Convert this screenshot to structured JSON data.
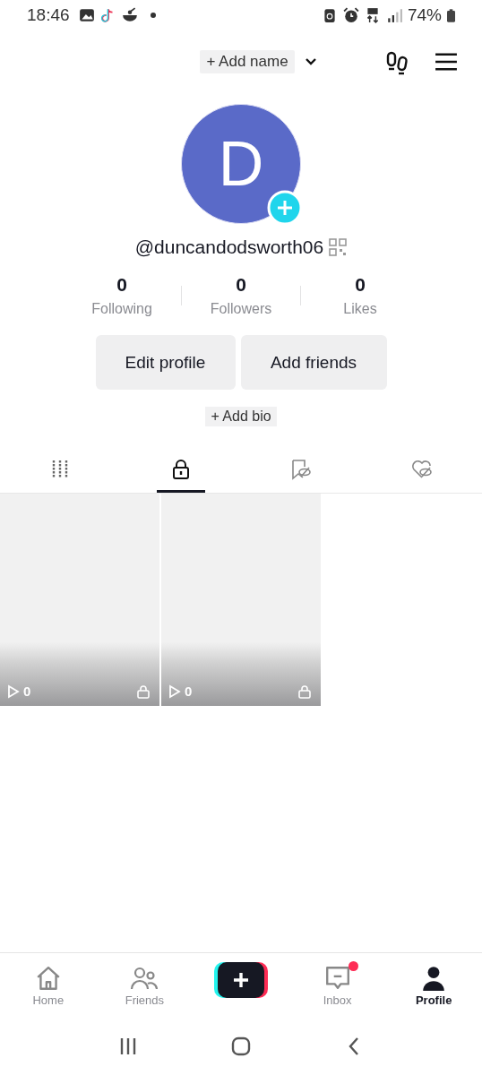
{
  "status_bar": {
    "time": "18:46",
    "battery": "74%"
  },
  "header": {
    "add_name": "+ Add name"
  },
  "profile": {
    "initial": "D",
    "username": "@duncandodsworth06"
  },
  "stats": [
    {
      "value": "0",
      "label": "Following"
    },
    {
      "value": "0",
      "label": "Followers"
    },
    {
      "value": "0",
      "label": "Likes"
    }
  ],
  "buttons": [
    "Edit profile",
    "Add friends"
  ],
  "add_bio": "+ Add bio",
  "tabs": [
    {
      "kind": "grid",
      "selected": false
    },
    {
      "kind": "lock",
      "selected": true
    },
    {
      "kind": "bookmark",
      "selected": false
    },
    {
      "kind": "heart",
      "selected": false
    }
  ],
  "videos": [
    {
      "views": "0",
      "locked": true
    },
    {
      "views": "0",
      "locked": true
    }
  ],
  "nav": [
    {
      "kind": "home",
      "label": "Home",
      "selected": false,
      "badge": false
    },
    {
      "kind": "friends",
      "label": "Friends",
      "selected": false,
      "badge": false
    },
    {
      "kind": "create"
    },
    {
      "kind": "inbox",
      "label": "Inbox",
      "selected": false,
      "badge": true
    },
    {
      "kind": "profile",
      "label": "Profile",
      "selected": true,
      "badge": false
    }
  ]
}
